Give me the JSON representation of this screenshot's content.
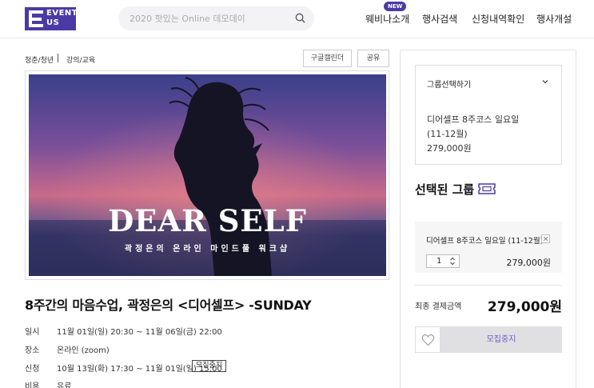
{
  "brand": {
    "logo_line1": "EVENT",
    "logo_line2": "US",
    "accent": "#4b3aa6"
  },
  "search": {
    "placeholder": "2020 핫있는 Online 데모데이",
    "icon": "search-icon"
  },
  "nav": {
    "new_badge": "NEW",
    "items": [
      {
        "label": "웨비나소개"
      },
      {
        "label": "행사검색"
      },
      {
        "label": "신청내역확인"
      },
      {
        "label": "행사개설"
      }
    ]
  },
  "breadcrumb": {
    "category": "청춘/청년",
    "subcategory": "강의/교육"
  },
  "toolbar": {
    "calendar_label": "구글캘린더",
    "share_label": "공유"
  },
  "hero": {
    "headline": "DEAR SELF",
    "subline": "곽정은의 온라인 마인드풀 워크샵"
  },
  "event": {
    "title": "8주간의 마음수업, 곽정은의 <디어셀프> -SUNDAY",
    "rows": [
      {
        "label": "일시",
        "value": "11월 01일(일) 20:30 ~ 11월 06일(금) 22:00"
      },
      {
        "label": "장소",
        "value": "온라인 (zoom)"
      },
      {
        "label": "신청",
        "value": "10월 13일(화) 17:30 ~ 11월 01일(일) 15:00"
      },
      {
        "label": "비용",
        "value": "유료"
      }
    ],
    "status_tag": "모집중지"
  },
  "panel": {
    "group_select_label": "그룹선택하기",
    "group_option_line1": "디어셀프 8주코스 일요일",
    "group_option_line2": "(11-12월)",
    "group_option_price": "279,000원",
    "selected_title": "선택된 그룹",
    "selected_name": "디어셀프 8주코스 일요일 (11-12월)",
    "quantity": "1",
    "selected_price": "279,000원",
    "total_label": "최종 결제금액",
    "total_value": "279,000원",
    "closed_button": "모집중지"
  }
}
